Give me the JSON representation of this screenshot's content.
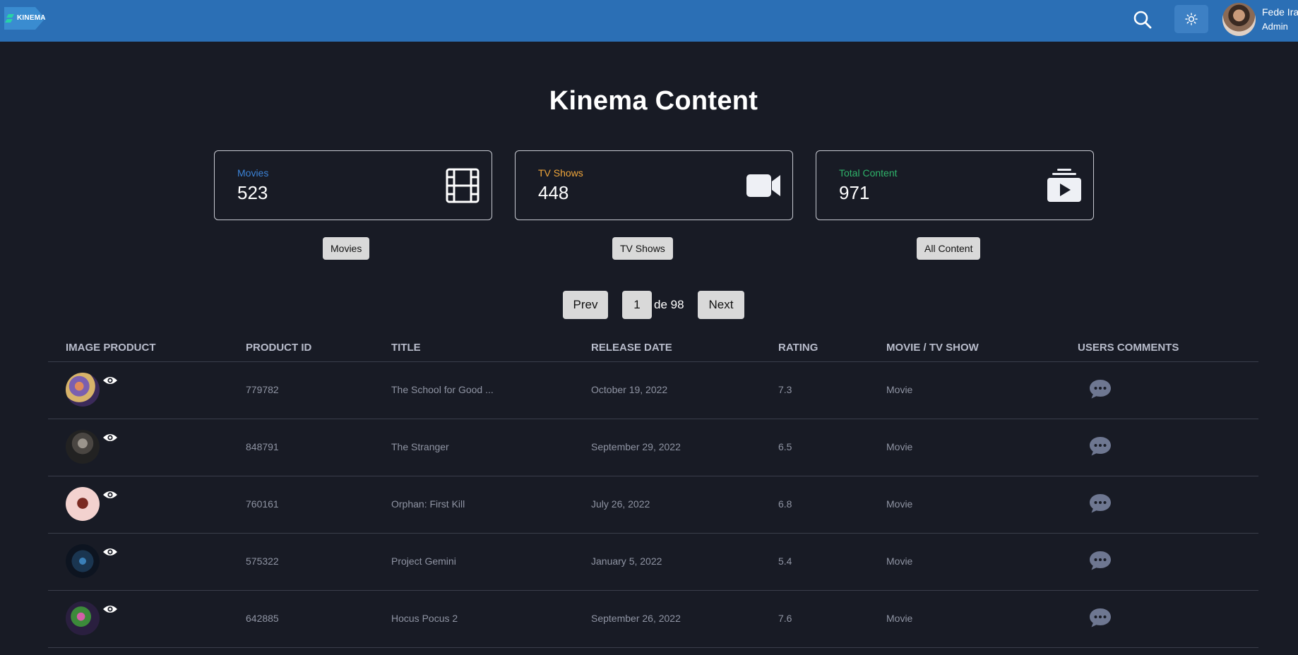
{
  "header": {
    "logo_text": "KINEMA",
    "user_name": "Fede Ira",
    "user_role": "Admin"
  },
  "page_title": "Kinema Content",
  "cards": {
    "movies": {
      "label": "Movies",
      "value": "523",
      "color": "#3b82d6",
      "icon": "film-icon"
    },
    "tvshows": {
      "label": "TV Shows",
      "value": "448",
      "color": "#f0a63a",
      "icon": "video-camera-icon"
    },
    "total": {
      "label": "Total Content",
      "value": "971",
      "color": "#2fb36a",
      "icon": "play-stack-icon"
    }
  },
  "filters": {
    "movies": "Movies",
    "tvshows": "TV Shows",
    "all": "All Content"
  },
  "pagination": {
    "prev": "Prev",
    "current": "1",
    "of_label": "de 98",
    "next": "Next"
  },
  "table": {
    "columns": [
      "IMAGE PRODUCT",
      "PRODUCT ID",
      "TITLE",
      "RELEASE DATE",
      "RATING",
      "MOVIE / TV SHOW",
      "USERS COMMENTS"
    ],
    "rows": [
      {
        "id": "779782",
        "title": "The School for Good ...",
        "date": "October 19, 2022",
        "rating": "7.3",
        "type": "Movie"
      },
      {
        "id": "848791",
        "title": "The Stranger",
        "date": "September 29, 2022",
        "rating": "6.5",
        "type": "Movie"
      },
      {
        "id": "760161",
        "title": "Orphan: First Kill",
        "date": "July 26, 2022",
        "rating": "6.8",
        "type": "Movie"
      },
      {
        "id": "575322",
        "title": "Project Gemini",
        "date": "January 5, 2022",
        "rating": "5.4",
        "type": "Movie"
      },
      {
        "id": "642885",
        "title": "Hocus Pocus 2",
        "date": "September 26, 2022",
        "rating": "7.6",
        "type": "Movie"
      }
    ]
  }
}
